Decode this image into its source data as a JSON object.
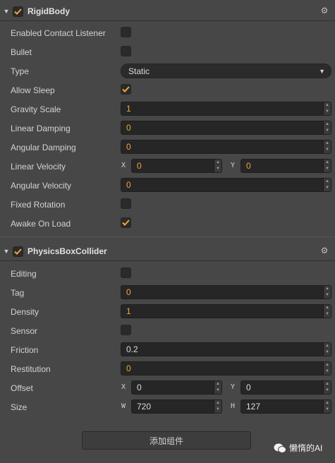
{
  "rigidbody": {
    "title": "RigidBody",
    "enabled": true,
    "fields": {
      "enabled_contact_listener": {
        "label": "Enabled Contact Listener",
        "checked": false
      },
      "bullet": {
        "label": "Bullet",
        "checked": false
      },
      "type": {
        "label": "Type",
        "value": "Static"
      },
      "allow_sleep": {
        "label": "Allow Sleep",
        "checked": true
      },
      "gravity_scale": {
        "label": "Gravity Scale",
        "value": "1"
      },
      "linear_damping": {
        "label": "Linear Damping",
        "value": "0"
      },
      "angular_damping": {
        "label": "Angular Damping",
        "value": "0"
      },
      "linear_velocity": {
        "label": "Linear Velocity",
        "x_label": "X",
        "x": "0",
        "y_label": "Y",
        "y": "0"
      },
      "angular_velocity": {
        "label": "Angular Velocity",
        "value": "0"
      },
      "fixed_rotation": {
        "label": "Fixed Rotation",
        "checked": false
      },
      "awake_on_load": {
        "label": "Awake On Load",
        "checked": true
      }
    }
  },
  "collider": {
    "title": "PhysicsBoxCollider",
    "enabled": true,
    "fields": {
      "editing": {
        "label": "Editing",
        "checked": false
      },
      "tag": {
        "label": "Tag",
        "value": "0"
      },
      "density": {
        "label": "Density",
        "value": "1"
      },
      "sensor": {
        "label": "Sensor",
        "checked": false
      },
      "friction": {
        "label": "Friction",
        "value": "0.2"
      },
      "restitution": {
        "label": "Restitution",
        "value": "0"
      },
      "offset": {
        "label": "Offset",
        "x_label": "X",
        "x": "0",
        "y_label": "Y",
        "y": "0"
      },
      "size": {
        "label": "Size",
        "w_label": "W",
        "w": "720",
        "h_label": "H",
        "h": "127"
      }
    }
  },
  "add_component_label": "添加组件",
  "watermark": "懒惰的AI",
  "colors": {
    "accent": "#f0a53c",
    "background": "#474747",
    "field": "#262626"
  }
}
